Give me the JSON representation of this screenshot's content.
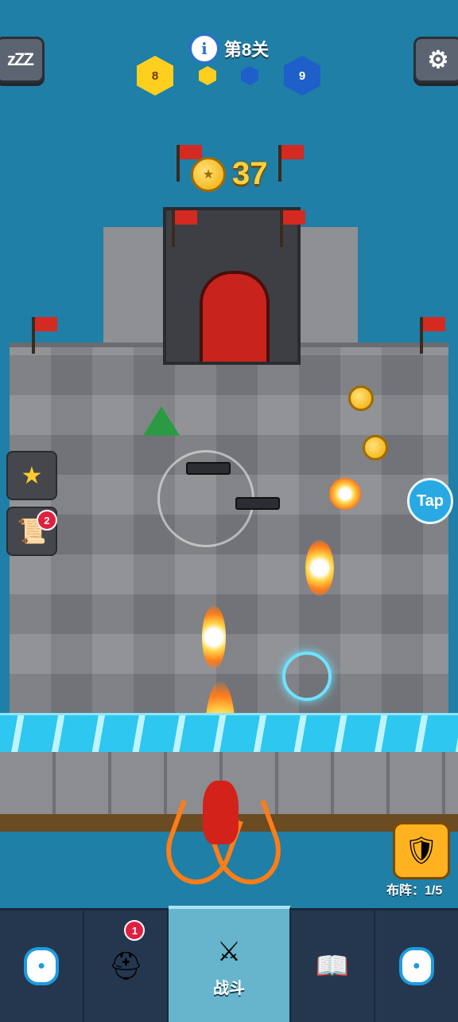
{
  "hud": {
    "sleep_label": "zZZ",
    "level_title": "第8关",
    "left_score": "8",
    "right_score": "9",
    "coins": "37"
  },
  "side": {
    "quest_badge": "2",
    "tap_label": "Tap"
  },
  "formation": {
    "label": "布阵：",
    "count": "1/5"
  },
  "nav": {
    "heroes_badge": "1",
    "battle_label": "战斗"
  },
  "colors": {
    "water": "#1f7fa6",
    "gold_team": "#ffcf1f",
    "blue_team": "#1e5fc9",
    "nav_bg": "#24374f",
    "nav_active": "#66b5cc"
  },
  "icons": [
    "sleep-icon",
    "info-icon",
    "settings-icon",
    "coin-icon",
    "trophy-icon",
    "scroll-icon",
    "lock-icon",
    "viking-helmet-icon",
    "crossed-swords-icon",
    "spellbook-icon",
    "formation-icon"
  ]
}
